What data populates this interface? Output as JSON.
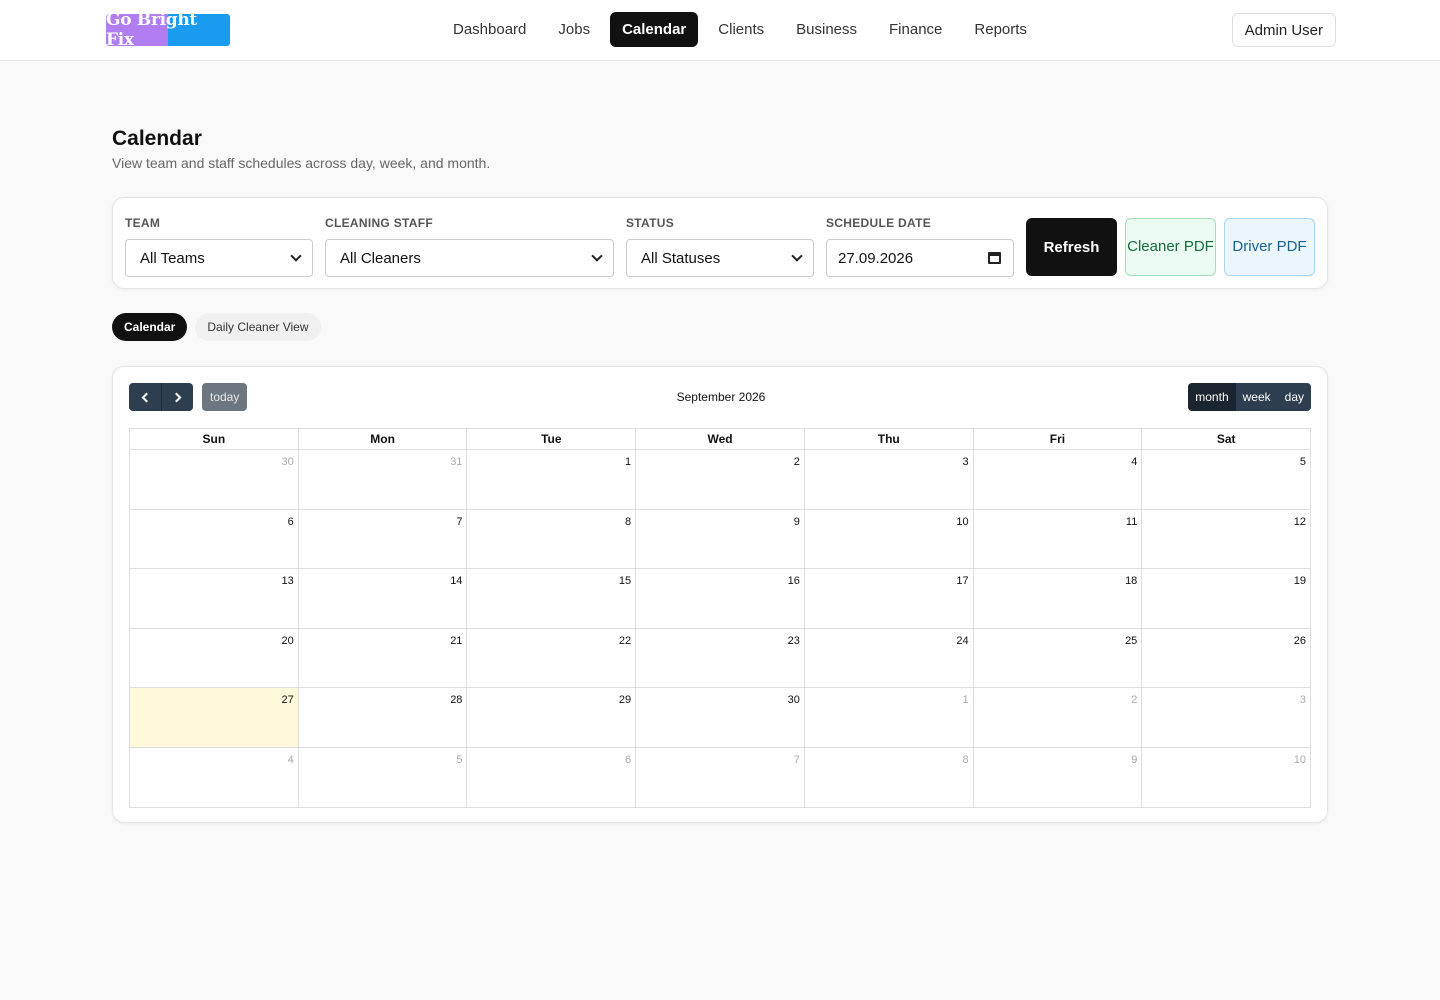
{
  "brand": {
    "logo_text": "Go Bright Fix"
  },
  "nav": {
    "items": [
      {
        "label": "Dashboard",
        "active": false
      },
      {
        "label": "Jobs",
        "active": false
      },
      {
        "label": "Calendar",
        "active": true
      },
      {
        "label": "Clients",
        "active": false
      },
      {
        "label": "Business",
        "active": false
      },
      {
        "label": "Finance",
        "active": false
      },
      {
        "label": "Reports",
        "active": false
      }
    ],
    "user_label": "Admin User"
  },
  "page": {
    "title": "Calendar",
    "subtitle": "View team and staff schedules across day, week, and month."
  },
  "filters": {
    "team": {
      "label": "Team",
      "value": "All Teams"
    },
    "staff": {
      "label": "Cleaning Staff",
      "value": "All Cleaners"
    },
    "status": {
      "label": "Status",
      "value": "All Statuses"
    },
    "date": {
      "label": "Schedule Date",
      "value": "27.09.2026"
    },
    "refresh_label": "Refresh",
    "cleaner_pdf_label": "Cleaner PDF",
    "driver_pdf_label": "Driver PDF"
  },
  "view_tabs": [
    {
      "label": "Calendar",
      "active": true
    },
    {
      "label": "Daily Cleaner View",
      "active": false
    }
  ],
  "calendar": {
    "title": "September 2026",
    "today_label": "today",
    "views": [
      {
        "label": "month",
        "active": true
      },
      {
        "label": "week",
        "active": false
      },
      {
        "label": "day",
        "active": false
      }
    ],
    "weekdays": [
      "Sun",
      "Mon",
      "Tue",
      "Wed",
      "Thu",
      "Fri",
      "Sat"
    ],
    "weeks": [
      [
        {
          "d": "30",
          "other": true
        },
        {
          "d": "31",
          "other": true
        },
        {
          "d": "1"
        },
        {
          "d": "2"
        },
        {
          "d": "3"
        },
        {
          "d": "4"
        },
        {
          "d": "5"
        }
      ],
      [
        {
          "d": "6"
        },
        {
          "d": "7"
        },
        {
          "d": "8"
        },
        {
          "d": "9"
        },
        {
          "d": "10"
        },
        {
          "d": "11"
        },
        {
          "d": "12"
        }
      ],
      [
        {
          "d": "13"
        },
        {
          "d": "14"
        },
        {
          "d": "15"
        },
        {
          "d": "16"
        },
        {
          "d": "17"
        },
        {
          "d": "18"
        },
        {
          "d": "19"
        }
      ],
      [
        {
          "d": "20"
        },
        {
          "d": "21"
        },
        {
          "d": "22"
        },
        {
          "d": "23"
        },
        {
          "d": "24"
        },
        {
          "d": "25"
        },
        {
          "d": "26"
        }
      ],
      [
        {
          "d": "27",
          "today": true
        },
        {
          "d": "28"
        },
        {
          "d": "29"
        },
        {
          "d": "30"
        },
        {
          "d": "1",
          "other": true
        },
        {
          "d": "2",
          "other": true
        },
        {
          "d": "3",
          "other": true
        }
      ],
      [
        {
          "d": "4",
          "other": true
        },
        {
          "d": "5",
          "other": true
        },
        {
          "d": "6",
          "other": true
        },
        {
          "d": "7",
          "other": true
        },
        {
          "d": "8",
          "other": true
        },
        {
          "d": "9",
          "other": true
        },
        {
          "d": "10",
          "other": true
        }
      ]
    ]
  }
}
